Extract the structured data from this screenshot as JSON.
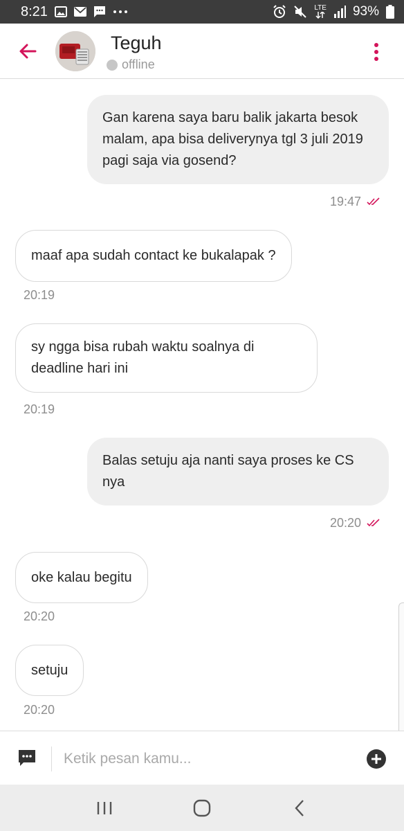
{
  "status_bar": {
    "time": "8:21",
    "left_icons": [
      "image-icon",
      "mail-icon",
      "message-icon",
      "more-dots-icon"
    ],
    "right_icons": [
      "alarm-icon",
      "mute-icon",
      "lte-icon",
      "signal-icon"
    ],
    "lte_label": "LTE",
    "battery_percent": "93%"
  },
  "header": {
    "back_icon": "back-arrow-icon",
    "contact_name": "Teguh",
    "presence": "offline",
    "menu_icon": "more-vertical-icon",
    "accent_color": "#d3145a"
  },
  "messages": [
    {
      "direction": "out",
      "text": "Gan karena saya baru balik jakarta besok malam, apa bisa deliverynya tgl 3 juli 2019 pagi saja via gosend?",
      "time": "19:47",
      "read": true
    },
    {
      "direction": "in",
      "text": "maaf apa sudah contact ke bukalapak ?",
      "time": "20:19"
    },
    {
      "direction": "in",
      "text": "sy ngga bisa rubah waktu soalnya di deadline hari ini",
      "time": "20:19"
    },
    {
      "direction": "out",
      "text": "Balas setuju aja nanti saya proses ke CS nya",
      "time": "20:20",
      "read": true
    },
    {
      "direction": "in",
      "text": "oke kalau begitu",
      "time": "20:20"
    },
    {
      "direction": "in",
      "text": "setuju",
      "time": "20:20"
    }
  ],
  "composer": {
    "template_icon": "chat-template-icon",
    "placeholder": "Ketik pesan kamu...",
    "add_icon": "add-circle-icon"
  },
  "nav_bar": {
    "icons": [
      "recents-icon",
      "home-icon",
      "back-icon"
    ]
  }
}
